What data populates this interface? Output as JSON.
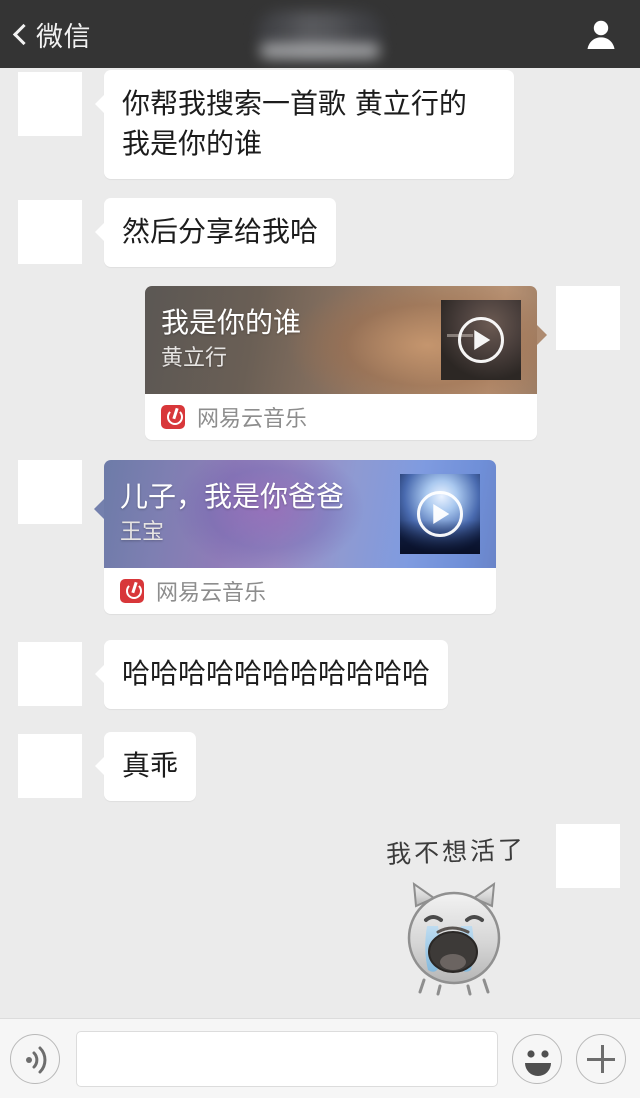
{
  "header": {
    "back_label": "微信",
    "back_icon": "chevron-left-icon",
    "title_redacted": "",
    "contact_icon": "person-icon",
    "bg_color": "#343434"
  },
  "chat": {
    "background_color": "#ebebeb",
    "messages": [
      {
        "id": "msg-1",
        "side": "left",
        "type": "text",
        "text": "你帮我搜索一首歌 黄立行的 我是你的谁"
      },
      {
        "id": "msg-2",
        "side": "left",
        "type": "text",
        "text": "然后分享给我哈"
      },
      {
        "id": "msg-3",
        "side": "right",
        "type": "music-card",
        "title": "我是你的谁",
        "artist": "黄立行",
        "source": "网易云音乐",
        "source_logo": "netease-music-icon",
        "play_icon": "play-icon",
        "theme": "brown"
      },
      {
        "id": "msg-4",
        "side": "left",
        "type": "music-card",
        "title": "儿子，我是你爸爸",
        "artist": "王宝",
        "source": "网易云音乐",
        "source_logo": "netease-music-icon",
        "play_icon": "play-icon",
        "theme": "blue"
      },
      {
        "id": "msg-5",
        "side": "left",
        "type": "text",
        "text": "哈哈哈哈哈哈哈哈哈哈哈"
      },
      {
        "id": "msg-6",
        "side": "left",
        "type": "text",
        "text": "真乖"
      },
      {
        "id": "msg-7",
        "side": "right",
        "type": "sticker",
        "caption": "我不想活了",
        "sticker_name": "crying-cat-sticker"
      }
    ]
  },
  "inputbar": {
    "voice_icon": "voice-wave-icon",
    "input_value": "",
    "input_placeholder": "",
    "emoji_icon": "smiley-icon",
    "plus_icon": "plus-icon"
  }
}
